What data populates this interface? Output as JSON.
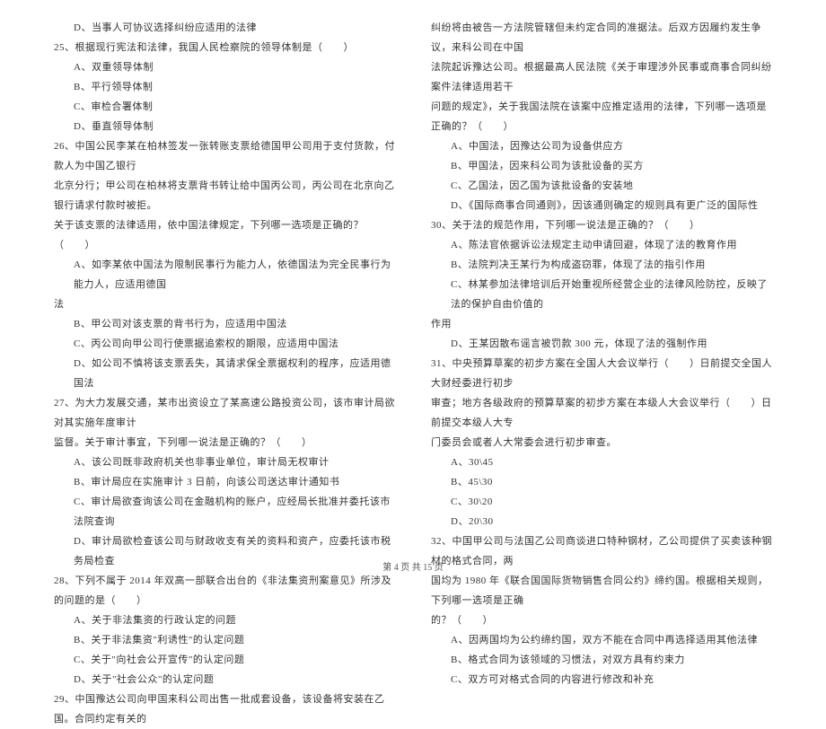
{
  "left_column": {
    "lines": [
      {
        "cls": "indent1",
        "text": "D、当事人可协议选择纠纷应适用的法律"
      },
      {
        "cls": "indent2",
        "text": "25、根据现行宪法和法律，我国人民检察院的领导体制是（　　）"
      },
      {
        "cls": "indent1",
        "text": "A、双重领导体制"
      },
      {
        "cls": "indent1",
        "text": "B、平行领导体制"
      },
      {
        "cls": "indent1",
        "text": "C、审检合署体制"
      },
      {
        "cls": "indent1",
        "text": "D、垂直领导体制"
      },
      {
        "cls": "indent2",
        "text": "26、中国公民李某在柏林签发一张转账支票给德国甲公司用于支付货款，付款人为中国乙银行"
      },
      {
        "cls": "indent2",
        "text": "北京分行；甲公司在柏林将支票背书转让给中国丙公司，丙公司在北京向乙银行请求付款时被拒。"
      },
      {
        "cls": "indent2",
        "text": "关于该支票的法律适用，依中国法律规定，下列哪一选项是正确的？（　　）"
      },
      {
        "cls": "indent1",
        "text": "A、如李某依中国法为限制民事行为能力人，依德国法为完全民事行为能力人，应适用德国"
      },
      {
        "cls": "indent2",
        "text": "法"
      },
      {
        "cls": "indent1",
        "text": "B、甲公司对该支票的背书行为，应适用中国法"
      },
      {
        "cls": "indent1",
        "text": "C、丙公司向甲公司行使票据追索权的期限，应适用中国法"
      },
      {
        "cls": "indent1",
        "text": "D、如公司不慎将该支票丢失，其请求保全票据权利的程序，应适用德国法"
      },
      {
        "cls": "indent2",
        "text": "27、为大力发展交通，某市出资设立了某高速公路投资公司，该市审计局欲对其实施年度审计"
      },
      {
        "cls": "indent2",
        "text": "监督。关于审计事宜，下列哪一说法是正确的？（　　）"
      },
      {
        "cls": "indent1",
        "text": "A、该公司既非政府机关也非事业单位，审计局无权审计"
      },
      {
        "cls": "indent1",
        "text": "B、审计局应在实施审计 3 日前，向该公司送达审计通知书"
      },
      {
        "cls": "indent1",
        "text": "C、审计局欲查询该公司在金融机构的账户，应经局长批准并委托该市法院查询"
      },
      {
        "cls": "indent1",
        "text": "D、审计局欲检查该公司与财政收支有关的资料和资产，应委托该市税务局检查"
      },
      {
        "cls": "indent2",
        "text": "28、下列不属于 2014 年双高一部联合出台的《非法集资刑案意见》所涉及的问题的是（　　）"
      },
      {
        "cls": "indent1",
        "text": "A、关于非法集资的行政认定的问题"
      },
      {
        "cls": "indent1",
        "text": "B、关于非法集资\"利诱性\"的认定问题"
      },
      {
        "cls": "indent1",
        "text": "C、关于\"向社会公开宣传\"的认定问题"
      },
      {
        "cls": "indent1",
        "text": "D、关于\"社会公众\"的认定问题"
      },
      {
        "cls": "indent2",
        "text": "29、中国豫达公司向甲国来科公司出售一批成套设备，该设备将安装在乙国。合同约定有关的"
      }
    ]
  },
  "right_column": {
    "lines": [
      {
        "cls": "indent2",
        "text": "纠纷将由被告一方法院管辖但未约定合同的准据法。后双方因履约发生争议，来科公司在中国"
      },
      {
        "cls": "indent2",
        "text": "法院起诉豫达公司。根据最高人民法院《关于审理涉外民事或商事合同纠纷案件法律适用若干"
      },
      {
        "cls": "indent2",
        "text": "问题的规定》，关于我国法院在该案中应推定适用的法律，下列哪一选项是正确的？（　　）"
      },
      {
        "cls": "indent1",
        "text": "A、中国法，因豫达公司为设备供应方"
      },
      {
        "cls": "indent1",
        "text": "B、甲国法，因来科公司为该批设备的买方"
      },
      {
        "cls": "indent1",
        "text": "C、乙国法，因乙国为该批设备的安装地"
      },
      {
        "cls": "indent1",
        "text": "D、《国际商事合同通则》，因该通则确定的规则具有更广泛的国际性"
      },
      {
        "cls": "indent2",
        "text": "30、关于法的规范作用，下列哪一说法是正确的？（　　）"
      },
      {
        "cls": "indent1",
        "text": "A、陈法官依据诉讼法规定主动申请回避，体现了法的教育作用"
      },
      {
        "cls": "indent1",
        "text": "B、法院判决王某行为构成盗窃罪，体现了法的指引作用"
      },
      {
        "cls": "indent1",
        "text": "C、林某参加法律培训后开始重视所经营企业的法律风险防控，反映了法的保护自由价值的"
      },
      {
        "cls": "indent2",
        "text": "作用"
      },
      {
        "cls": "indent1",
        "text": "D、王某因散布谣言被罚款 300 元，体现了法的强制作用"
      },
      {
        "cls": "indent2",
        "text": "31、中央预算草案的初步方案在全国人大会议举行（　　）日前提交全国人大财经委进行初步"
      },
      {
        "cls": "indent2",
        "text": "审查；地方各级政府的预算草案的初步方案在本级人大会议举行（　　）日前提交本级人大专"
      },
      {
        "cls": "indent2",
        "text": "门委员会或者人大常委会进行初步审查。"
      },
      {
        "cls": "indent1",
        "text": "A、30\\45"
      },
      {
        "cls": "indent1",
        "text": "B、45\\30"
      },
      {
        "cls": "indent1",
        "text": "C、30\\20"
      },
      {
        "cls": "indent1",
        "text": "D、20\\30"
      },
      {
        "cls": "indent2",
        "text": "32、中国甲公司与法国乙公司商谈进口特种钢材，乙公司提供了买卖该种钢材的格式合同，两"
      },
      {
        "cls": "indent2",
        "text": "国均为 1980 年《联合国国际货物销售合同公约》缔约国。根据相关规则，下列哪一选项是正确"
      },
      {
        "cls": "indent2",
        "text": "的？（　　）"
      },
      {
        "cls": "indent1",
        "text": "A、因两国均为公约缔约国，双方不能在合同中再选择适用其他法律"
      },
      {
        "cls": "indent1",
        "text": "B、格式合同为该领域的习惯法，对双方具有约束力"
      },
      {
        "cls": "indent1",
        "text": "C、双方可对格式合同的内容进行修改和补充"
      }
    ]
  },
  "footer": "第 4 页 共 15 页"
}
